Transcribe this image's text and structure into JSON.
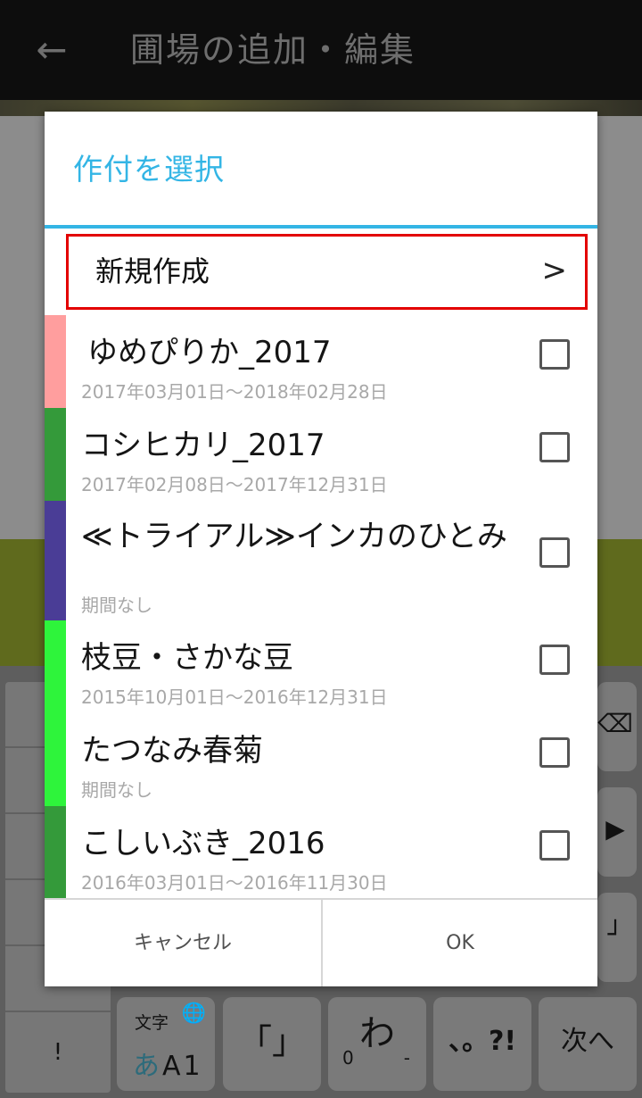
{
  "app_bar": {
    "back_icon": "←",
    "title": "圃場の追加・編集"
  },
  "dialog": {
    "title": "作付を選択",
    "new_item": {
      "label": "新規作成",
      "chevron": ">"
    },
    "items": [
      {
        "name": "ゆめぴりか_2017",
        "period": "2017年03月01日～2018年02月28日",
        "color": "#ff9e9e",
        "checked": false
      },
      {
        "name": "コシヒカリ_2017",
        "period": "2017年02月08日～2017年12月31日",
        "color": "#349a3a",
        "checked": false
      },
      {
        "name": "≪トライアル≫インカのひとみ",
        "period": "期間なし",
        "color": "#4a3d96",
        "checked": false
      },
      {
        "name": "枝豆・さかな豆",
        "period": "2015年10月01日～2016年12月31日",
        "color": "#2ef43b",
        "checked": false
      },
      {
        "name": "たつなみ春菊",
        "period": "期間なし",
        "color": "#2ef43b",
        "checked": false
      },
      {
        "name": "こしいぶき_2016",
        "period": "2016年03月01日～2016年11月30日",
        "color": "#349a3a",
        "checked": false
      }
    ],
    "cancel_label": "キャンセル",
    "ok_label": "OK"
  },
  "keyboard": {
    "mode_small": "文字",
    "mode_globe": "🌐",
    "mode_kana": "あ",
    "mode_alnum": "A1",
    "bracket_key": "「」",
    "wa_key": "わ",
    "wa_sub_left": "0",
    "wa_sub_right": "-",
    "punct_key": "、。?!",
    "next_key": "次へ",
    "left_dash": "-",
    "left_excl": "!"
  }
}
